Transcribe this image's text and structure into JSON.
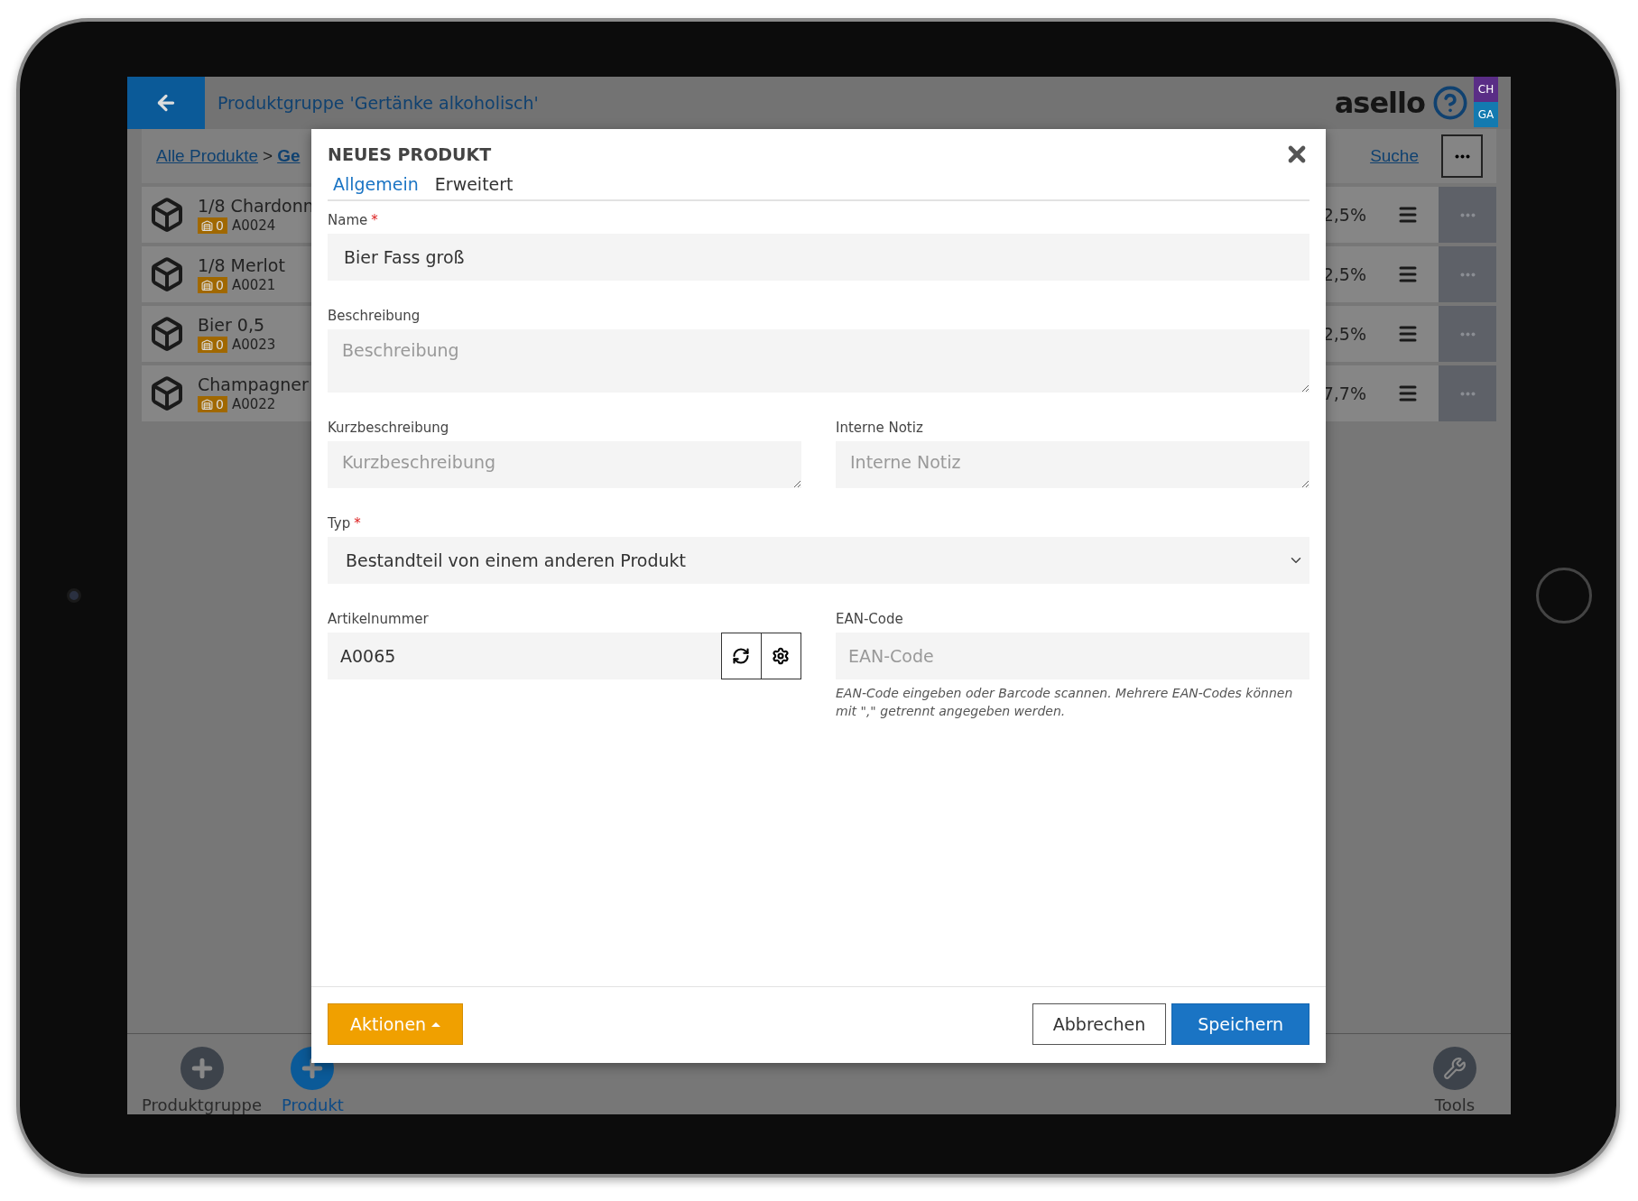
{
  "header": {
    "title": "Produktgruppe 'Gertänke alkoholisch'",
    "logo": "asello",
    "badges": [
      {
        "label": "CH",
        "color": "#5a2d86"
      },
      {
        "label": "GA",
        "color": "#137ab0"
      }
    ]
  },
  "breadcrumb": {
    "items": [
      {
        "label": "Alle Produkte"
      },
      {
        "label": "Ge"
      }
    ],
    "separator": ">",
    "search_link": "Suche"
  },
  "products": [
    {
      "name": "1/8 Chardonn",
      "stock": "0",
      "sku": "A0024",
      "tax": "2,5%"
    },
    {
      "name": "1/8 Merlot",
      "stock": "0",
      "sku": "A0021",
      "tax": "2,5%"
    },
    {
      "name": "Bier 0,5",
      "stock": "0",
      "sku": "A0023",
      "tax": "2,5%"
    },
    {
      "name": "Champagner",
      "stock": "0",
      "sku": "A0022",
      "tax": "7,7%"
    }
  ],
  "bottom_bar": [
    {
      "label": "Produktgruppe",
      "kind": "add",
      "selected": false
    },
    {
      "label": "Produkt",
      "kind": "add",
      "selected": true
    },
    {
      "label": "Tools",
      "kind": "tools",
      "selected": false
    }
  ],
  "dialog": {
    "title": "NEUES PRODUKT",
    "tabs": [
      {
        "label": "Allgemein",
        "selected": true
      },
      {
        "label": "Erweitert",
        "selected": false
      }
    ],
    "name": {
      "label": "Name",
      "required_mark": "*",
      "value": "Bier Fass groß"
    },
    "description": {
      "label": "Beschreibung",
      "placeholder": "Beschreibung"
    },
    "short_description": {
      "label": "Kurzbeschreibung",
      "placeholder": "Kurzbeschreibung"
    },
    "internal_note": {
      "label": "Interne Notiz",
      "placeholder": "Interne Notiz"
    },
    "type": {
      "label": "Typ",
      "required_mark": "*",
      "value": "Bestandteil von einem anderen Produkt"
    },
    "article_number": {
      "label": "Artikelnummer",
      "value": "A0065"
    },
    "ean": {
      "label": "EAN-Code",
      "placeholder": "EAN-Code",
      "hint": "EAN-Code eingeben oder Barcode scannen. Mehrere EAN-Codes können mit \",\" getrennt angegeben werden."
    },
    "actions_button": "Aktionen",
    "cancel_button": "Abbrechen",
    "save_button": "Speichern"
  }
}
